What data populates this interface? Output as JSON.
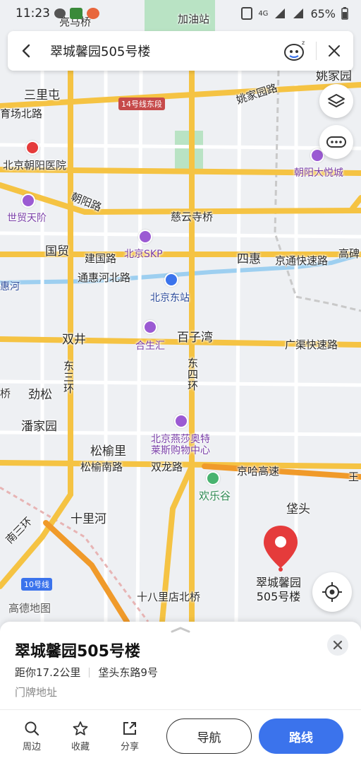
{
  "colors": {
    "accent": "#3b73ec",
    "marker": "#e53b3b",
    "road_major": "#f5c343",
    "road_expressway": "#f09a2a",
    "water": "#9dcff0",
    "park": "#b9e3c4",
    "map_bg": "#eef0f3"
  },
  "status_bar": {
    "time": "11:23",
    "battery": "65%",
    "network": "4G",
    "icons": [
      "wechat-icon",
      "play-store-icon",
      "app-badge-icon",
      "nfc-icon",
      "signal-icon",
      "battery-icon"
    ]
  },
  "search": {
    "query": "翠城馨园505号楼"
  },
  "map": {
    "labels": {
      "liangmaqiao": "亮马桥",
      "jiayouzhan": "加油站",
      "sanlitun": "三里屯",
      "yaojiayuan": "姚家园",
      "yaojiayuan_road": "姚家园路",
      "gongti_north": "育场北路",
      "line14": "14号线东段",
      "chaoyang_hospital": "北京朝阳医院",
      "chaoyang_joycity": "朝阳大悦城",
      "chaoyang_road": "朝阳路",
      "shimao": "世贸天阶",
      "ciyunsi": "慈云寺桥",
      "guomao": "国贸",
      "jianguo_road": "建国路",
      "skp": "北京SKP",
      "sihui": "四惠",
      "jingtong": "京通快速路",
      "gaobei": "高碑",
      "huiriver": "惠河",
      "tonghui_north": "通惠河北路",
      "beijing_east_station": "北京东站",
      "shuangjing": "双井",
      "hesheng": "合生汇",
      "baiziwan": "百子湾",
      "guangqu": "广渠快速路",
      "east3ring": "东三环",
      "east4ring": "东四环",
      "qiao": "桥",
      "jinsong": "劲松",
      "panjiayuan": "潘家园",
      "songyuli": "松榆里",
      "songyu_south": "松榆南路",
      "shuanglong": "双龙路",
      "jingha": "京哈高速",
      "wang": "王",
      "yansha_l1": "北京燕莎奥特",
      "yansha_l2": "莱斯购物中心",
      "happyvalley": "欢乐谷",
      "daitou": "垡头",
      "shilihe": "十里河",
      "south3ring": "南三环",
      "shibalidian": "十八里店北桥",
      "line10": "10号线",
      "gaode_map": "高德地图"
    },
    "marker": {
      "line1": "翠城馨园",
      "line2": "505号楼"
    }
  },
  "place": {
    "title": "翠城馨园505号楼",
    "distance": "距你17.2公里",
    "address": "垡头东路9号",
    "tag": "门牌地址"
  },
  "actions": {
    "nearby": "周边",
    "favorite": "收藏",
    "share": "分享",
    "navigate": "导航",
    "route": "路线"
  }
}
